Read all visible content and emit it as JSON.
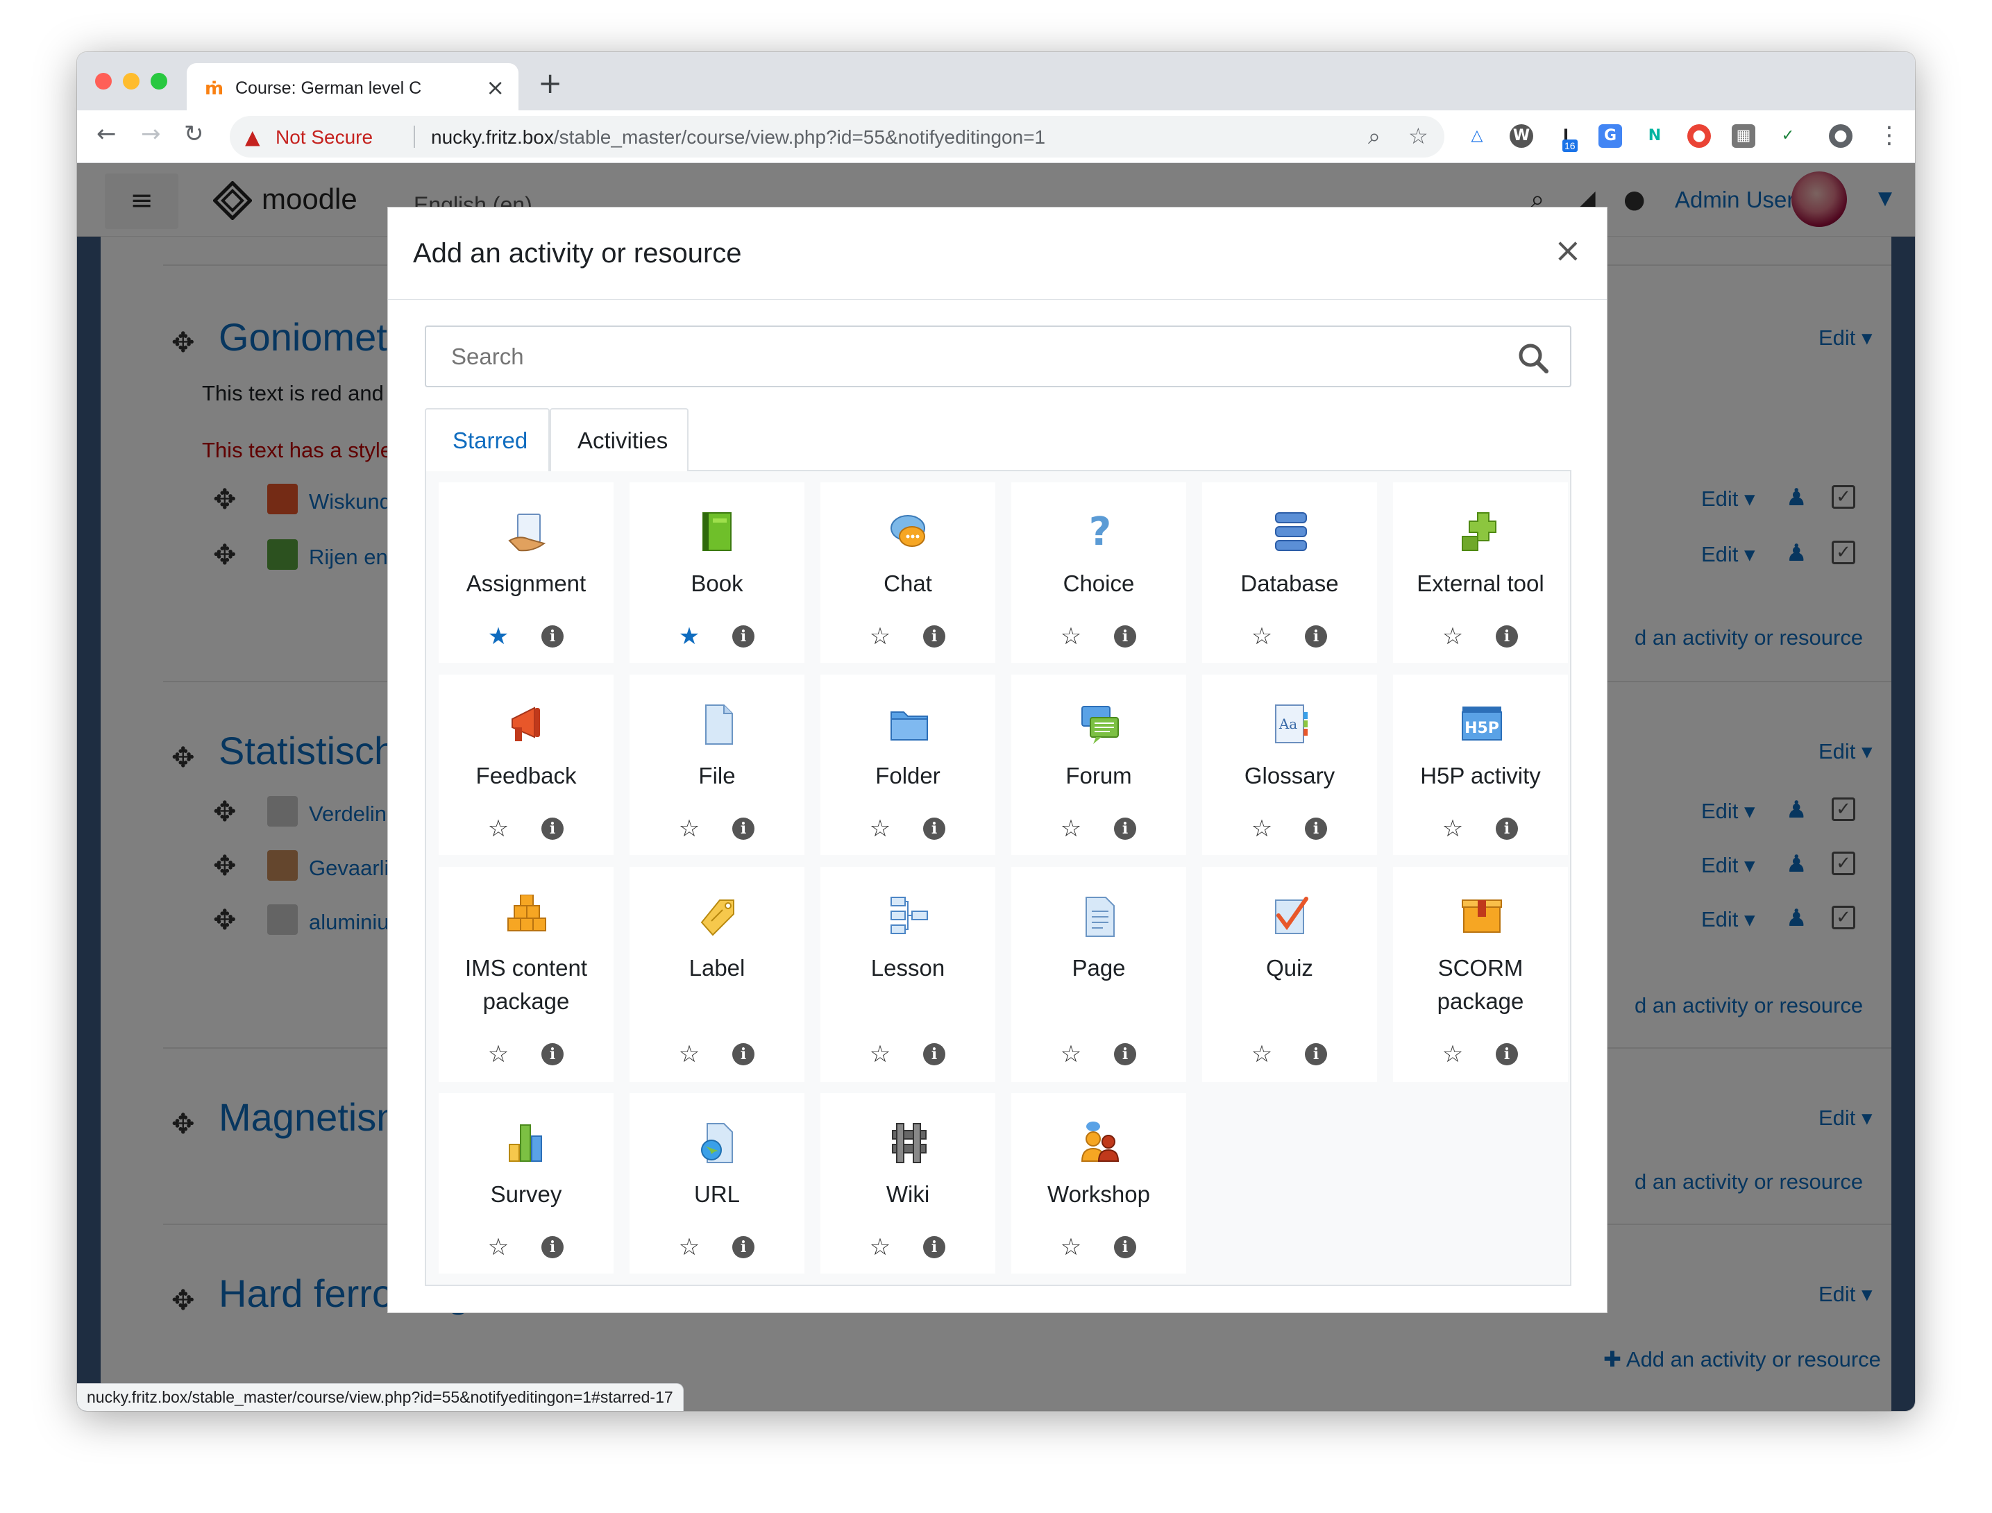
{
  "browser": {
    "tab_title": "Course: German level C",
    "tab_favicon": "moodle-favicon",
    "security_label": "Not Secure",
    "url_host": "nucky.fritz.box",
    "url_path": "/stable_master/course/view.php?id=55&notifyeditingon=1",
    "extension_badge": "16",
    "status_url": "nucky.fritz.box/stable_master/course/view.php?id=55&notifyeditingon=1#starred-17"
  },
  "navbar": {
    "logo_text": "moodle",
    "language": "English (en)",
    "username": "Admin User"
  },
  "course": {
    "sections": [
      {
        "title": "Goniometrie",
        "edit": "Edit"
      },
      {
        "title": "Statistische",
        "edit": "Edit"
      },
      {
        "title": "Magnetisme",
        "edit": "Edit"
      },
      {
        "title": "Hard ferromag",
        "edit": "Edit"
      }
    ],
    "text_red_centered": "This text is red and ce",
    "text_style": "This text has a style at",
    "activities": [
      {
        "label": "Wiskundige",
        "edit": "Edit"
      },
      {
        "label": "Rijen en re",
        "edit": "Edit"
      },
      {
        "label": "Verdeling v",
        "edit": "Edit"
      },
      {
        "label": "Gevaarlijke",
        "edit": "Edit"
      },
      {
        "label": "aluminium",
        "edit": "Edit"
      }
    ],
    "add_activity_partial": "d an activity or resource",
    "add_activity": "Add an activity or resource"
  },
  "modal": {
    "title": "Add an activity or resource",
    "search_placeholder": "Search",
    "tabs": [
      "Starred",
      "Activities"
    ],
    "items": [
      {
        "name": "Assignment",
        "starred": true,
        "icon": "assignment-icon"
      },
      {
        "name": "Book",
        "starred": true,
        "icon": "book-icon"
      },
      {
        "name": "Chat",
        "starred": false,
        "icon": "chat-icon"
      },
      {
        "name": "Choice",
        "starred": false,
        "icon": "choice-icon"
      },
      {
        "name": "Database",
        "starred": false,
        "icon": "database-icon"
      },
      {
        "name": "External tool",
        "starred": false,
        "icon": "external-tool-icon"
      },
      {
        "name": "Feedback",
        "starred": false,
        "icon": "feedback-icon"
      },
      {
        "name": "File",
        "starred": false,
        "icon": "file-icon"
      },
      {
        "name": "Folder",
        "starred": false,
        "icon": "folder-icon"
      },
      {
        "name": "Forum",
        "starred": false,
        "icon": "forum-icon"
      },
      {
        "name": "Glossary",
        "starred": false,
        "icon": "glossary-icon"
      },
      {
        "name": "H5P activity",
        "starred": false,
        "icon": "h5p-icon"
      },
      {
        "name": "IMS content package",
        "starred": false,
        "icon": "ims-package-icon"
      },
      {
        "name": "Label",
        "starred": false,
        "icon": "label-icon"
      },
      {
        "name": "Lesson",
        "starred": false,
        "icon": "lesson-icon"
      },
      {
        "name": "Page",
        "starred": false,
        "icon": "page-icon"
      },
      {
        "name": "Quiz",
        "starred": false,
        "icon": "quiz-icon"
      },
      {
        "name": "SCORM package",
        "starred": false,
        "icon": "scorm-icon"
      },
      {
        "name": "Survey",
        "starred": false,
        "icon": "survey-icon"
      },
      {
        "name": "URL",
        "starred": false,
        "icon": "url-icon"
      },
      {
        "name": "Wiki",
        "starred": false,
        "icon": "wiki-icon"
      },
      {
        "name": "Workshop",
        "starred": false,
        "icon": "workshop-icon"
      }
    ]
  },
  "colors": {
    "link": "#0f6cbf",
    "star_active": "#0f6cbf",
    "red_text": "#c00000",
    "backdrop": "rgba(0,0,0,0.5)"
  }
}
